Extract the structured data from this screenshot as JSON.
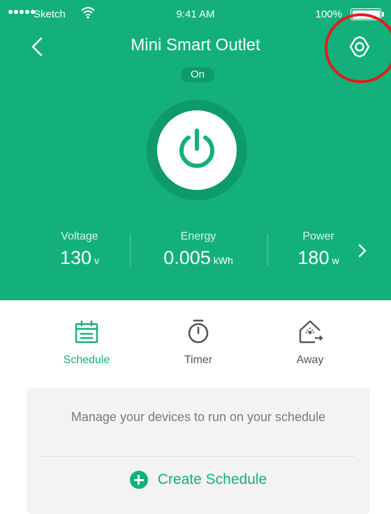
{
  "status_bar": {
    "carrier": "Sketch",
    "time": "9:41 AM",
    "battery": "100%"
  },
  "header": {
    "title": "Mini Smart Outlet",
    "state": "On",
    "back_icon": "chevron-left-icon",
    "settings_icon": "gear-icon"
  },
  "metrics": [
    {
      "label": "Voltage",
      "value": "130",
      "unit": "v"
    },
    {
      "label": "Energy",
      "value": "0.005",
      "unit": "kWh"
    },
    {
      "label": "Power",
      "value": "180",
      "unit": "w"
    }
  ],
  "tabs": [
    {
      "label": "Schedule",
      "icon": "calendar-icon",
      "active": true
    },
    {
      "label": "Timer",
      "icon": "stopwatch-icon",
      "active": false
    },
    {
      "label": "Away",
      "icon": "away-home-icon",
      "active": false
    }
  ],
  "card": {
    "description": "Manage your devices to run on your schedule",
    "button_label": "Create Schedule"
  },
  "colors": {
    "primary": "#13b07b",
    "highlight_ring": "#e41b1b"
  }
}
